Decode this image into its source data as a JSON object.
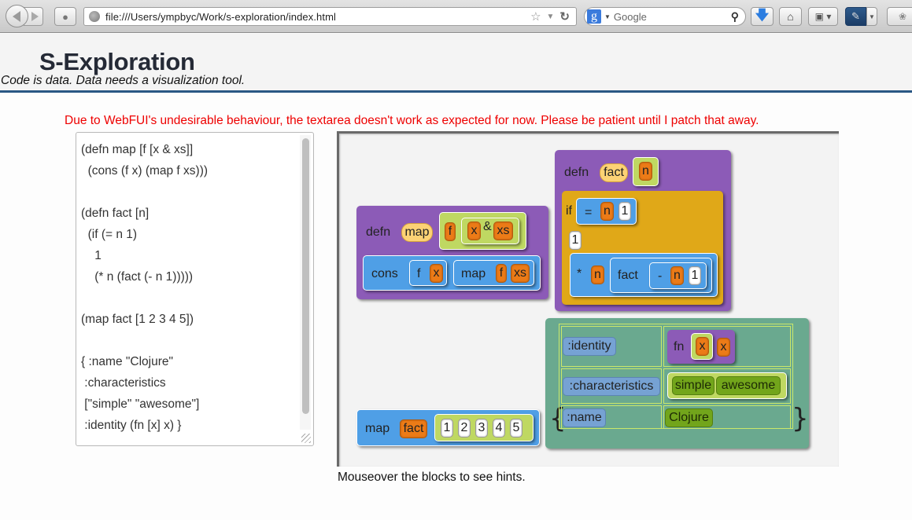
{
  "browser": {
    "url": "file:///Users/ympbyc/Work/s-exploration/index.html",
    "search_engine": "Google",
    "search_placeholder": "Google",
    "icons": {
      "back": "back-arrow-icon",
      "forward": "forward-arrow-icon",
      "addons": "addons-icon",
      "globe": "globe-icon",
      "bookmark_star": "star-icon",
      "history": "dropdown-triangle-icon",
      "reload": "reload-icon",
      "search": "magnifier-icon",
      "downloads": "download-arrow-icon",
      "home": "home-icon",
      "bookmarks": "bookmarks-icon",
      "devtools": "pen-icon",
      "extension": "bug-icon"
    }
  },
  "header": {
    "title": "S-Exploration",
    "tagline": "Code is data. Data needs a visualization tool."
  },
  "warning": "Due to WebFUI's undesirable behaviour, the textarea doesn't work as expected for now. Please be patient until I patch that away.",
  "editor": {
    "lines": [
      "(defn map [f [x & xs]]",
      "  (cons (f x) (map f xs)))",
      "",
      "(defn fact [n]",
      "  (if (= n 1)",
      "    1",
      "    (* n (fact (- n 1)))))",
      "",
      "(map fact [1 2 3 4 5])",
      "",
      "{ :name \"Clojure\"",
      " :characteristics",
      " [\"simple\" \"awesome\"]",
      " :identity (fn [x] x) }"
    ]
  },
  "blocks": {
    "defn_map": {
      "keyword": "defn",
      "name": "map",
      "params": [
        "f",
        "x",
        "&",
        "xs"
      ],
      "body": {
        "fn": "cons",
        "arg1": [
          "f",
          "x"
        ],
        "arg2": [
          "map",
          "f",
          "xs"
        ]
      }
    },
    "defn_fact": {
      "keyword": "defn",
      "name": "fact",
      "params": [
        "n"
      ],
      "if_kw": "if",
      "cond": [
        "=",
        "n",
        "1"
      ],
      "then": "1",
      "else": {
        "op": "*",
        "a": "n",
        "call": "fact",
        "sub": [
          "-",
          "n",
          "1"
        ]
      }
    },
    "map_call": {
      "fn": "map",
      "arg": "fact",
      "vec": [
        "1",
        "2",
        "3",
        "4",
        "5"
      ]
    },
    "hashmap": {
      "open": "{",
      "close": "}",
      "rows": [
        {
          "key": ":identity",
          "fn_kw": "fn",
          "param": "x",
          "body": "x"
        },
        {
          "key": ":characteristics",
          "values": [
            "simple",
            "awesome"
          ]
        },
        {
          "key": ":name",
          "value": "Clojure"
        }
      ]
    }
  },
  "hint": "Mouseover the blocks to see hints.",
  "colors": {
    "defn": "#8c5bb7",
    "if": "#e0a818",
    "call": "#4f9fe6",
    "vector": "#bfd862",
    "symbol": "#ec7b17",
    "map": "#6aa98f",
    "keyword": "#76a2d3",
    "string": "#72a51b",
    "warning": "#ee0000",
    "header_rule": "#2a5784"
  }
}
